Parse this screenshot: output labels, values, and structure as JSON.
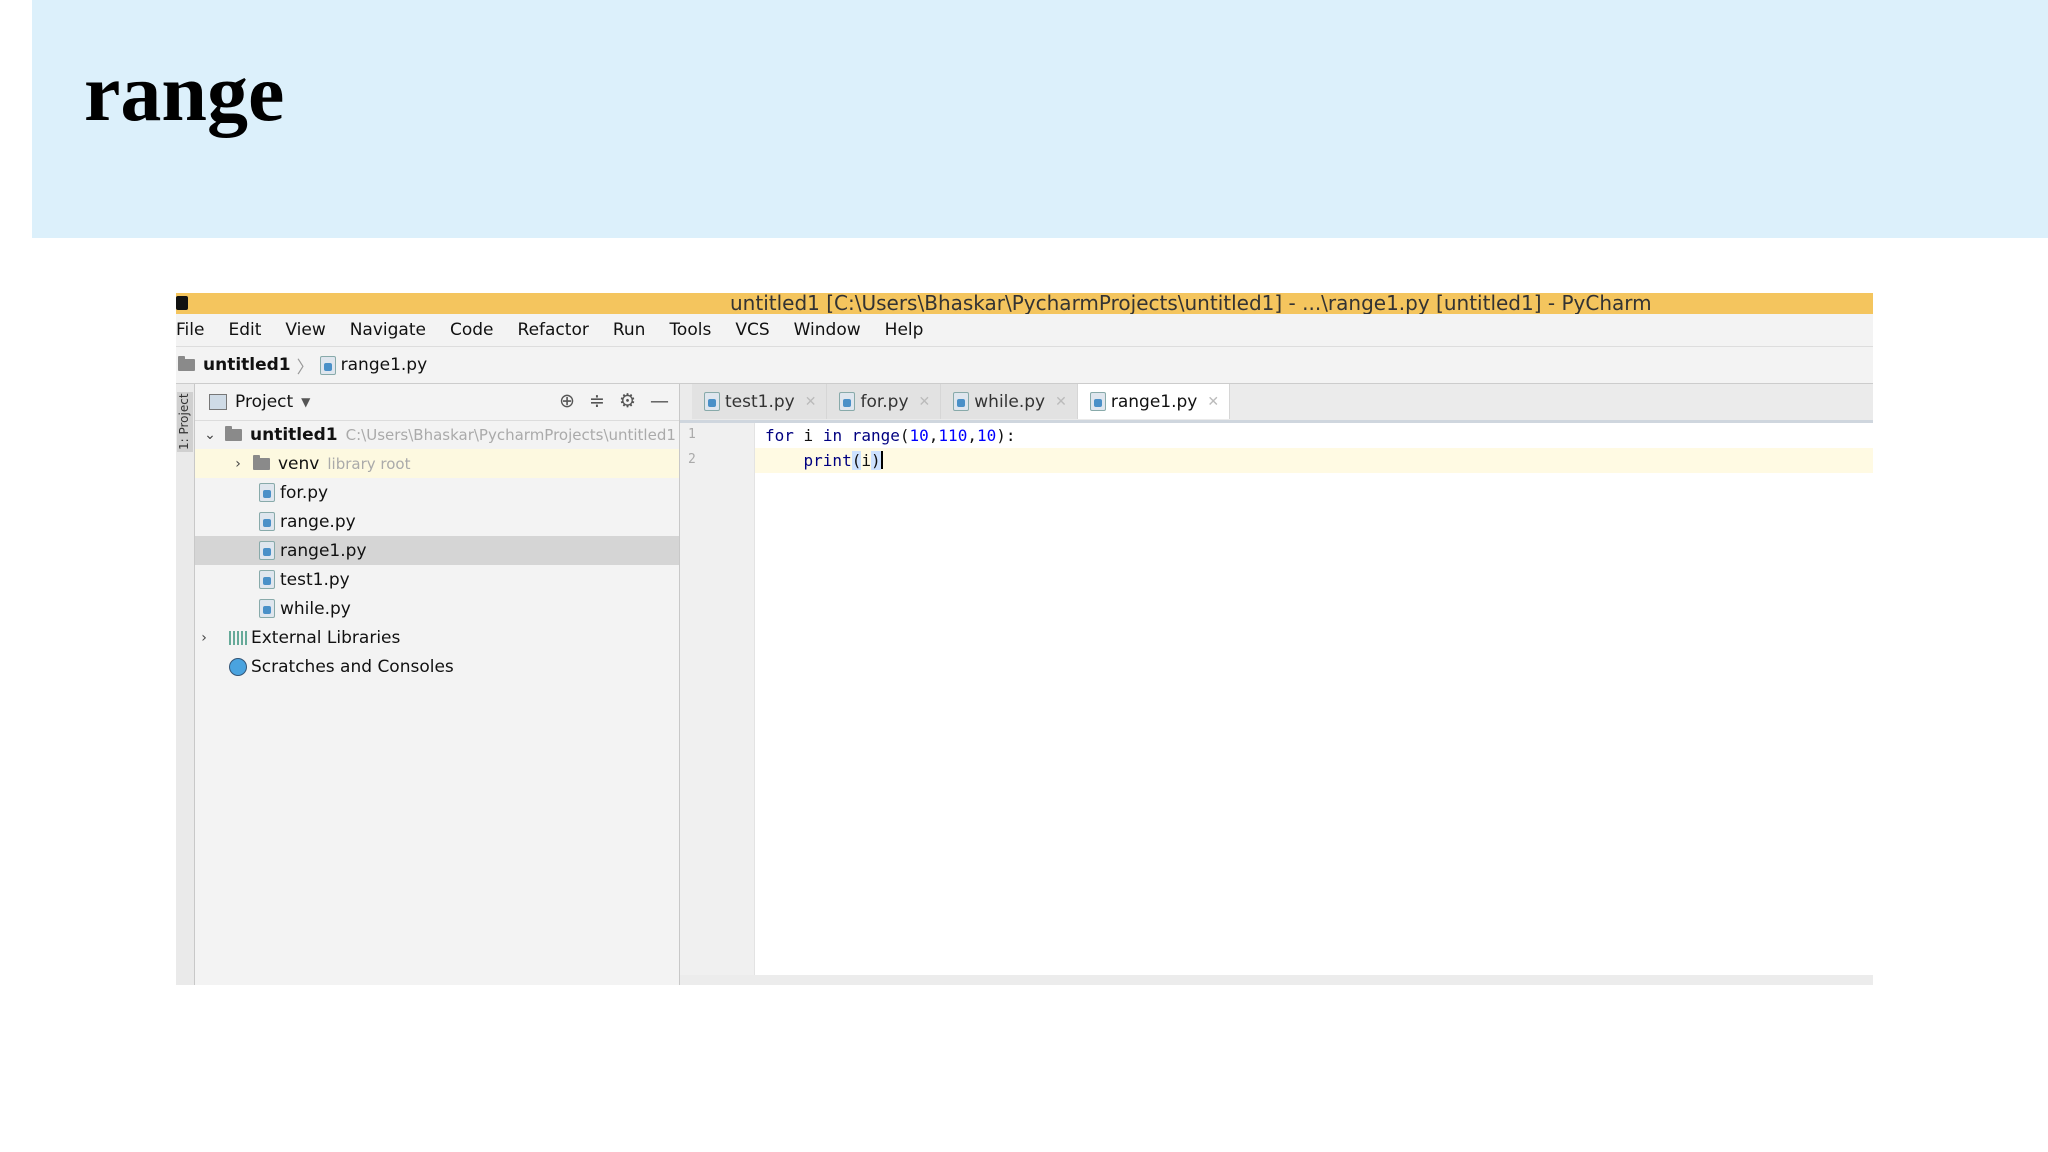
{
  "slide": {
    "title": "range"
  },
  "window": {
    "title": "untitled1 [C:\\Users\\Bhaskar\\PycharmProjects\\untitled1] - ...\\range1.py [untitled1] - PyCharm"
  },
  "menu": [
    "File",
    "Edit",
    "View",
    "Navigate",
    "Code",
    "Refactor",
    "Run",
    "Tools",
    "VCS",
    "Window",
    "Help"
  ],
  "breadcrumb": {
    "project": "untitled1",
    "file": "range1.py"
  },
  "side_strip": {
    "label": "1: Project"
  },
  "project_panel": {
    "title": "Project",
    "tree": [
      {
        "label": "untitled1",
        "path": "C:\\Users\\Bhaskar\\PycharmProjects\\untitled1"
      },
      {
        "label": "venv",
        "note": "library root"
      },
      {
        "label": "for.py"
      },
      {
        "label": "range.py"
      },
      {
        "label": "range1.py"
      },
      {
        "label": "test1.py"
      },
      {
        "label": "while.py"
      },
      {
        "label": "External Libraries"
      },
      {
        "label": "Scratches and Consoles"
      }
    ]
  },
  "editor": {
    "tabs": [
      "test1.py",
      "for.py",
      "while.py",
      "range1.py"
    ],
    "active_tab": "range1.py",
    "line_numbers": [
      "1",
      "2"
    ],
    "code": {
      "line1": {
        "kw_for": "for",
        "var": " i ",
        "kw_in": "in",
        "fn": " range",
        "open": "(",
        "n1": "10",
        "c1": ",",
        "n2": "110",
        "c2": ",",
        "n3": "10",
        "close": "):"
      },
      "line2": {
        "indent": "    ",
        "fn": "print",
        "open": "(",
        "arg": "i",
        "close": ")"
      }
    }
  }
}
